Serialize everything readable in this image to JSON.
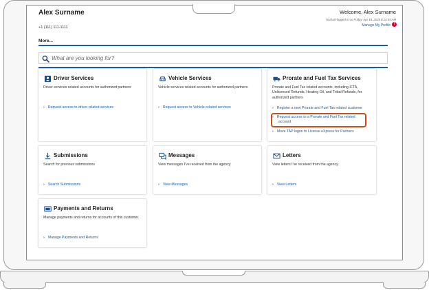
{
  "header": {
    "user_name": "Alex Surname",
    "phone": "+1 (111) 111-1111",
    "welcome": "Welcome, Alex Surname",
    "last_logged": "You last logged in on Friday, Apr 18, 2025 8:14:55 AM",
    "manage_profile": "Manage My Profile",
    "alert_count": "!",
    "alert_color": "#c8102e"
  },
  "more_label": "More...",
  "search": {
    "placeholder": "What are you looking for?"
  },
  "cards": {
    "driver": {
      "title": "Driver Services",
      "icon": "id-card-icon",
      "description": "Driver services related accounts for authorized partners",
      "links": [
        "Request access to driver-related services"
      ]
    },
    "vehicle": {
      "title": "Vehicle Services",
      "icon": "car-icon",
      "description": "Vehicle services related accounts for authorized partners",
      "links": [
        "Request access to Vehicle-related services"
      ]
    },
    "prorate": {
      "title": "Prorate and Fuel Tax Services",
      "icon": "truck-icon",
      "description": "Prorate and Fuel Tax related accounts, including IFTA, Unlicensed Refunds, Heating Oil, and Tribal Refunds, for authorized partners",
      "links": [
        "Register a new Prorate and Fuel Tax related customer",
        "Request access to a Prorate and Fuel Tax related account",
        "Move TAP logon to License eXpress for Partners"
      ]
    },
    "submissions": {
      "title": "Submissions",
      "icon": "download-icon",
      "description": "Search for previous submissions",
      "links": [
        "Search Submissions"
      ]
    },
    "messages": {
      "title": "Messages",
      "icon": "chat-icon",
      "description": "View messages I've received from the agency.",
      "links": [
        "View Messages"
      ]
    },
    "letters": {
      "title": "Letters",
      "icon": "envelope-icon",
      "description": "View letters I've received from the agency.",
      "links": [
        "View Letters"
      ]
    },
    "payments": {
      "title": "Payments and Returns",
      "icon": "payment-icon",
      "description": "Manage payments and returns for accounts of this customer.",
      "links": [
        "Manage Payments and Returns"
      ]
    }
  },
  "colors": {
    "accent": "#1a5ea8",
    "highlight": "#c4501e"
  }
}
